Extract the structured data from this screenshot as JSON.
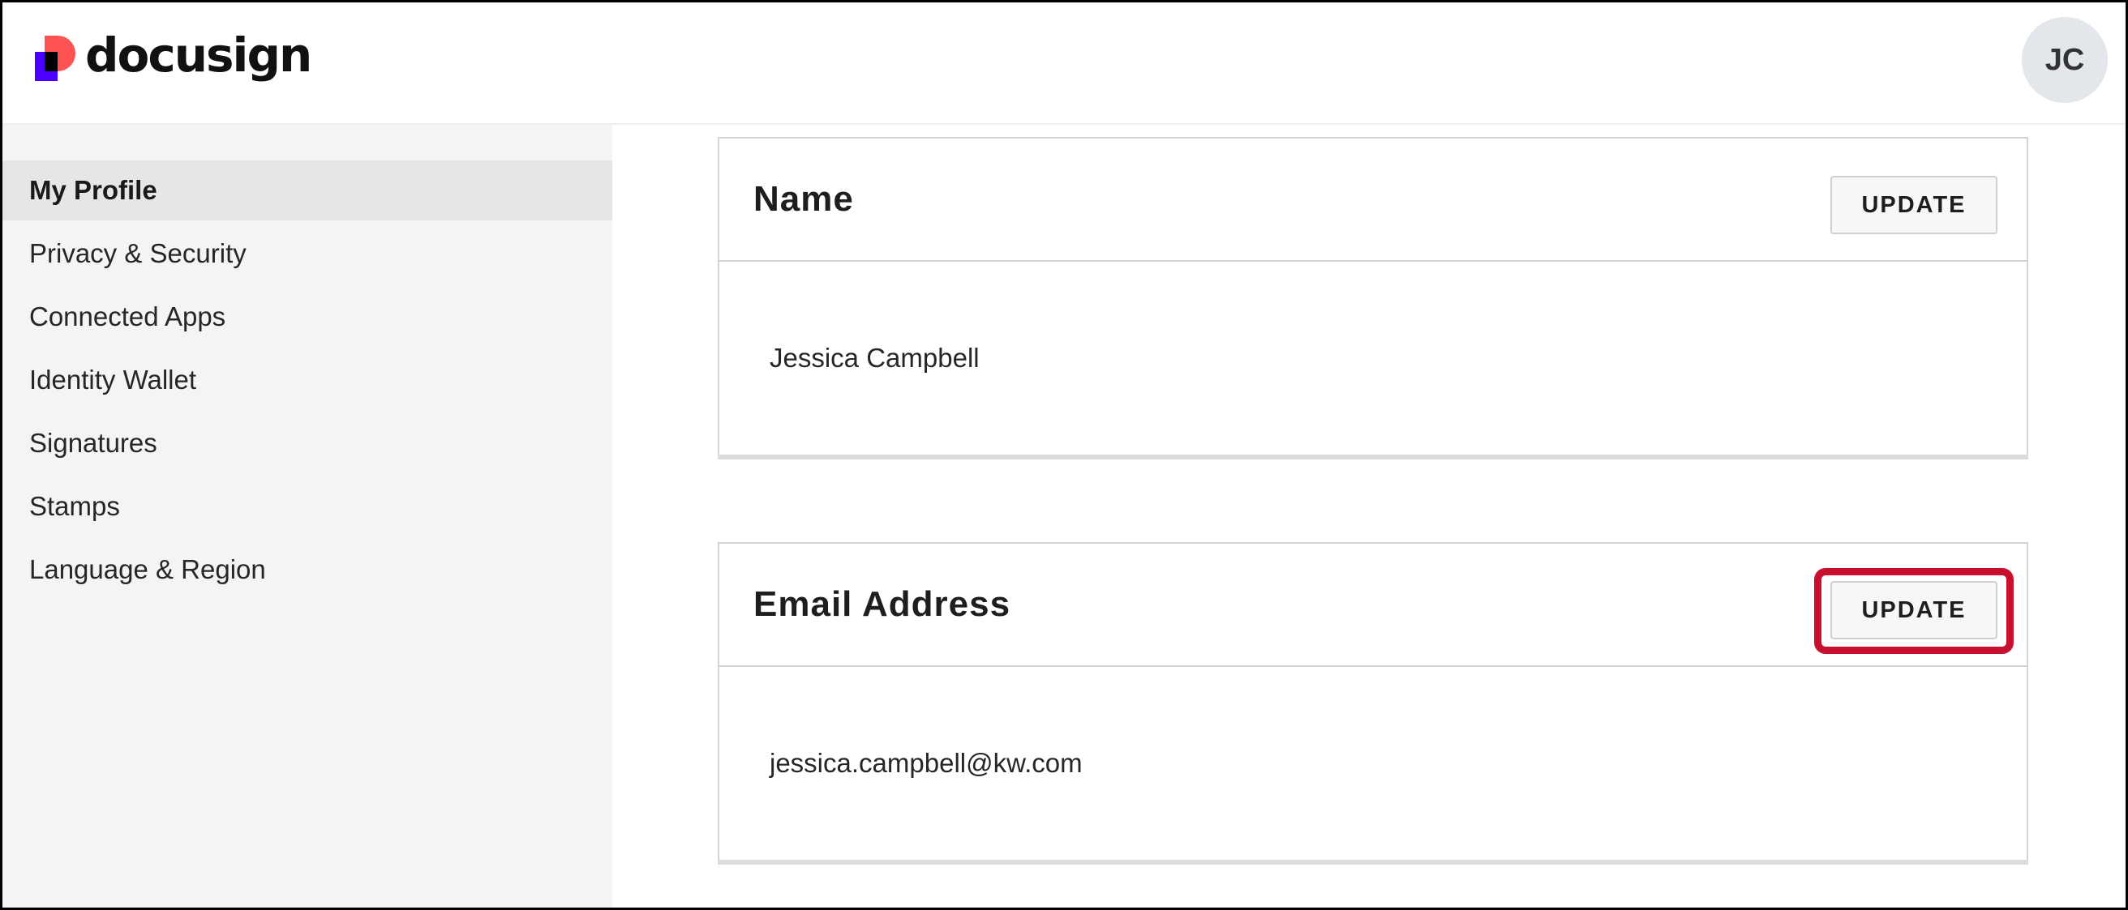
{
  "header": {
    "brand": "docusign",
    "logo_icon": "docusign-logo-icon",
    "avatar_initials": "JC"
  },
  "sidebar": {
    "items": [
      {
        "label": "My Profile",
        "active": true
      },
      {
        "label": "Privacy & Security",
        "active": false
      },
      {
        "label": "Connected Apps",
        "active": false
      },
      {
        "label": "Identity Wallet",
        "active": false
      },
      {
        "label": "Signatures",
        "active": false
      },
      {
        "label": "Stamps",
        "active": false
      },
      {
        "label": "Language & Region",
        "active": false
      }
    ]
  },
  "main": {
    "cards": [
      {
        "title": "Name",
        "button_label": "UPDATE",
        "value": "Jessica Campbell"
      },
      {
        "title": "Email Address",
        "button_label": "UPDATE",
        "value": "jessica.campbell@kw.com"
      }
    ]
  },
  "colors": {
    "highlight": "#c8102e",
    "logo_purple": "#4c00ff",
    "logo_red": "#ff5252",
    "sidebar_bg": "#f4f4f4",
    "active_item_bg": "#e6e6e6"
  }
}
